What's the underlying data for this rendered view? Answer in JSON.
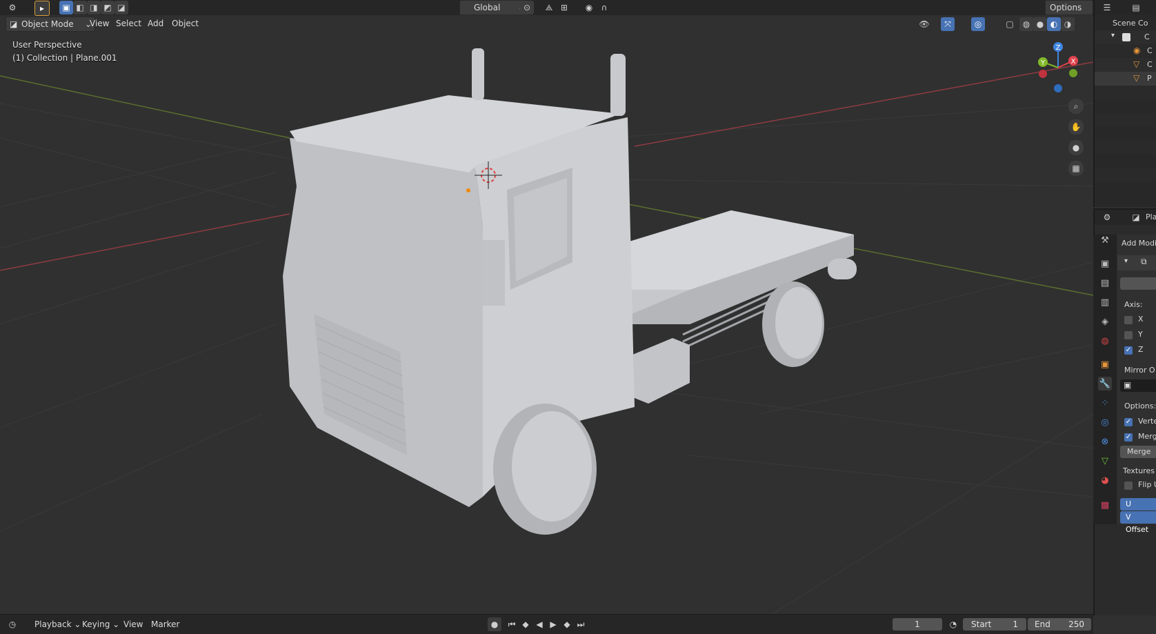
{
  "header": {
    "transform_orientation": "Global",
    "options_label": "Options"
  },
  "viewport_header": {
    "mode": "Object Mode",
    "menus": [
      "View",
      "Select",
      "Add",
      "Object"
    ]
  },
  "viewport": {
    "perspective_label": "User Perspective",
    "collection_label": "(1) Collection | Plane.001",
    "gizmo_axes": {
      "x": "X",
      "y": "Y",
      "z": "Z"
    }
  },
  "outliner": {
    "title": "Scene Co",
    "rows": [
      "C",
      "C",
      "C",
      "P"
    ]
  },
  "properties": {
    "header_label": "Pla",
    "add_modifier": "Add Modi",
    "axis_label": "Axis:",
    "axis": [
      {
        "label": "X",
        "checked": false
      },
      {
        "label": "Y",
        "checked": false
      },
      {
        "label": "Z",
        "checked": true
      }
    ],
    "mirror_object_label": "Mirror O",
    "options_label": "Options:",
    "options": [
      {
        "label": "Verte",
        "checked": true
      },
      {
        "label": "Merg",
        "checked": true
      }
    ],
    "merge_field": "Merge",
    "textures_label": "Textures",
    "flip_label": "Flip U",
    "u_offset": "U Offset",
    "v_offset": "V Offset"
  },
  "timeline": {
    "menus": [
      "Playback",
      "Keying",
      "View",
      "Marker"
    ],
    "current_frame": "1",
    "start_label": "Start",
    "start_value": "1",
    "end_label": "End",
    "end_value": "250"
  },
  "colors": {
    "accent": "#4772b3",
    "x_axis": "#e0434f",
    "y_axis": "#82b92a",
    "z_axis": "#3f85e0"
  }
}
